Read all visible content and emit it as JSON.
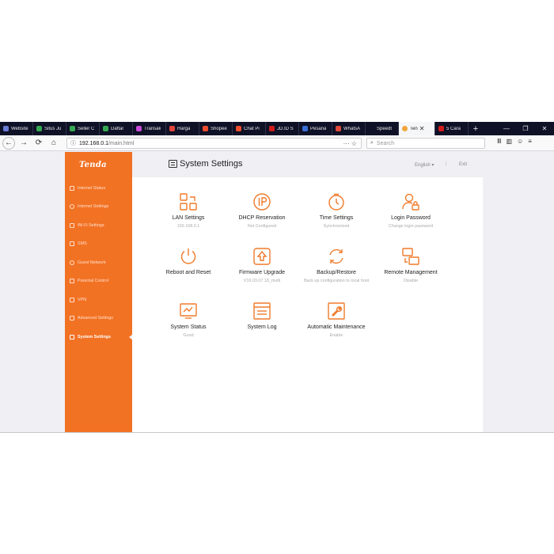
{
  "tabs": [
    {
      "label": "Website",
      "favicon_color": "#6a7bd6"
    },
    {
      "label": "Situs Ju",
      "favicon_color": "#36a852"
    },
    {
      "label": "Seller C",
      "favicon_color": "#36a852"
    },
    {
      "label": "Daftar",
      "favicon_color": "#36a852"
    },
    {
      "label": "Transak",
      "favicon_color": "#c94ad6"
    },
    {
      "label": "Harga",
      "favicon_color": "#e0453a"
    },
    {
      "label": "Shopee",
      "favicon_color": "#ee4d2d"
    },
    {
      "label": "Chat Pi",
      "favicon_color": "#ee4d2d"
    },
    {
      "label": "JD.ID S",
      "favicon_color": "#d21b1b"
    },
    {
      "label": "Pesana",
      "favicon_color": "#3b6fd6"
    },
    {
      "label": "WhatsA",
      "favicon_color": "#e14a3a"
    },
    {
      "label": "Speedt",
      "favicon_color": "#0f1126"
    }
  ],
  "active_tab": {
    "label": "Ten",
    "close": "✕",
    "favicon_color": "#f2a53a"
  },
  "next_tab": {
    "label": "5 Cara",
    "favicon_color": "#d21b1b"
  },
  "new_tab": "+",
  "window_controls": {
    "minimize": "—",
    "restore": "❐",
    "close": "✕"
  },
  "nav": {
    "back": "←",
    "forward": "→",
    "reload": "⟳",
    "home": "⌂"
  },
  "url": {
    "host": "192.168.0.1",
    "path": "/main.html",
    "actions": "··· ☆"
  },
  "search": {
    "placeholder": "Search"
  },
  "toolbar_right": {
    "library": "Ⅲ",
    "sidebar": "▥",
    "account": "☺",
    "menu": "≡"
  },
  "brand": {
    "logo": "Tenda",
    "accent": "#f27224"
  },
  "sidebar": {
    "items": [
      {
        "label": "Internet Status"
      },
      {
        "label": "Internet Settings"
      },
      {
        "label": "Wi-Fi Settings"
      },
      {
        "label": "SMS"
      },
      {
        "label": "Guest Network"
      },
      {
        "label": "Parental Control"
      },
      {
        "label": "VPN"
      },
      {
        "label": "Advanced Settings"
      },
      {
        "label": "System Settings"
      }
    ],
    "active_index": 8
  },
  "header": {
    "title": "System Settings",
    "language": "English",
    "language_caret": "▾",
    "separator": "|",
    "exit": "Exit"
  },
  "cards": [
    {
      "title": "LAN Settings",
      "subtitle": "192.168.0.1",
      "icon": "lan-icon"
    },
    {
      "title": "DHCP Reservation",
      "subtitle": "Not Configured",
      "icon": "ip-icon",
      "icon_text": "IP"
    },
    {
      "title": "Time Settings",
      "subtitle": "Synchronized",
      "icon": "clock-icon"
    },
    {
      "title": "Login Password",
      "subtitle": "Change login password",
      "icon": "user-lock-icon"
    },
    {
      "title": "Reboot and Reset",
      "subtitle": "",
      "icon": "power-icon"
    },
    {
      "title": "Firmware Upgrade",
      "subtitle": "V16.03.07.18_multi",
      "icon": "upgrade-icon"
    },
    {
      "title": "Backup/Restore",
      "subtitle": "Back up configuration to local host",
      "icon": "refresh-icon"
    },
    {
      "title": "Remote Management",
      "subtitle": "Disable",
      "icon": "remote-icon"
    },
    {
      "title": "System Status",
      "subtitle": "Good",
      "icon": "monitor-icon"
    },
    {
      "title": "System Log",
      "subtitle": "",
      "icon": "log-icon"
    },
    {
      "title": "Automatic Maintenance",
      "subtitle": "Enable",
      "icon": "wrench-icon"
    }
  ]
}
